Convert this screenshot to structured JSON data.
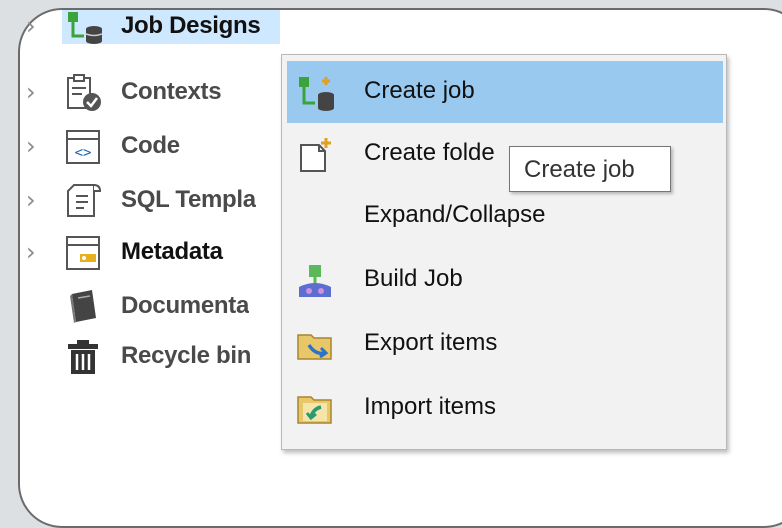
{
  "tree": {
    "items": [
      {
        "label": "Job Designs",
        "icon": "job-designs-icon"
      },
      {
        "label": "Contexts",
        "icon": "contexts-icon"
      },
      {
        "label": "Code",
        "icon": "code-icon"
      },
      {
        "label": "SQL Templa",
        "icon": "sql-templates-icon"
      },
      {
        "label": "Metadata",
        "icon": "metadata-icon"
      },
      {
        "label": "Documenta",
        "icon": "documentation-icon"
      },
      {
        "label": "Recycle bin",
        "icon": "recycle-bin-icon"
      }
    ]
  },
  "context_menu": {
    "items": [
      {
        "label": "Create job",
        "icon": "create-job-icon"
      },
      {
        "label": "Create folde",
        "icon": "create-folder-icon"
      },
      {
        "label": "Expand/Collapse",
        "icon": ""
      },
      {
        "label": "Build Job",
        "icon": "build-job-icon"
      },
      {
        "label": "Export items",
        "icon": "export-items-icon"
      },
      {
        "label": "Import items",
        "icon": "import-items-icon"
      }
    ]
  },
  "tooltip": {
    "text": "Create job"
  },
  "colors": {
    "tree_selection": "#cde8ff",
    "menu_highlight": "#99c9ef",
    "menu_background": "#f2f2f2"
  }
}
